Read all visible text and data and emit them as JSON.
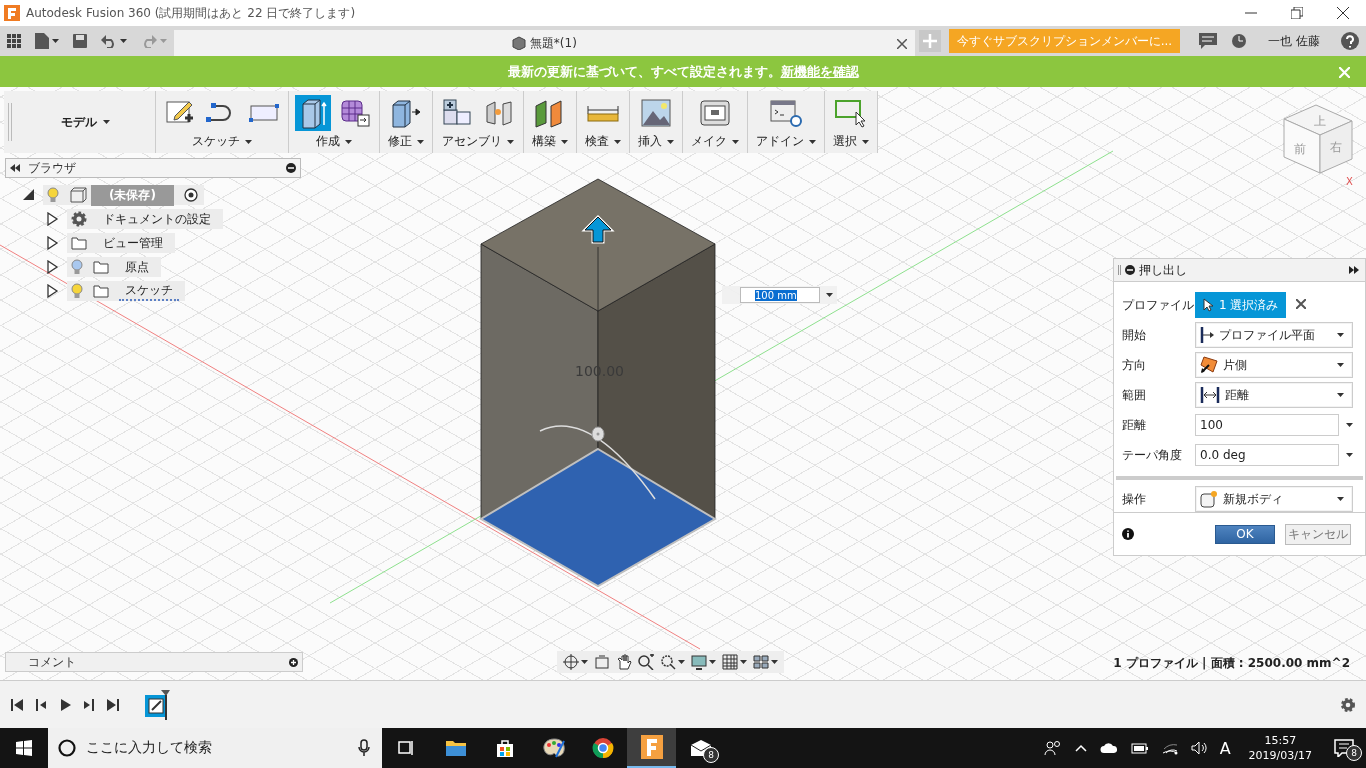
{
  "title_bar": {
    "title": "Autodesk Fusion 360 (試用期間はあと 22 日で終了します)"
  },
  "app_bar": {
    "document_tab": "無題*(1)",
    "subscribe_button": "今すぐサブスクリプションメンバーに...",
    "user_name": "一也 佐藤"
  },
  "banner": {
    "message": "最新の更新に基づいて、すべて設定されます。",
    "link": "新機能を確認"
  },
  "toolbar": {
    "workspace": "モデル",
    "groups": [
      {
        "label": "スケッチ",
        "tools": [
          {
            "kind": "sketch",
            "selected": false
          },
          {
            "kind": "spline",
            "selected": false
          },
          {
            "kind": "rect",
            "selected": false
          }
        ]
      },
      {
        "label": "作成",
        "tools": [
          {
            "kind": "box",
            "selected": true
          },
          {
            "kind": "form",
            "selected": false
          }
        ]
      },
      {
        "label": "修正",
        "tools": [
          {
            "kind": "presspull",
            "selected": false
          }
        ]
      },
      {
        "label": "アセンブリ",
        "tools": [
          {
            "kind": "component",
            "selected": false
          },
          {
            "kind": "joint",
            "selected": false
          }
        ]
      },
      {
        "label": "構築",
        "tools": [
          {
            "kind": "plane",
            "selected": false
          }
        ]
      },
      {
        "label": "検査",
        "tools": [
          {
            "kind": "measure",
            "selected": false
          }
        ]
      },
      {
        "label": "挿入",
        "tools": [
          {
            "kind": "image",
            "selected": false
          }
        ]
      },
      {
        "label": "メイク",
        "tools": [
          {
            "kind": "print",
            "selected": false
          }
        ]
      },
      {
        "label": "アドイン",
        "tools": [
          {
            "kind": "script",
            "selected": false
          }
        ]
      },
      {
        "label": "選択",
        "tools": [
          {
            "kind": "select",
            "selected": false
          }
        ]
      }
    ]
  },
  "browser": {
    "title": "ブラウザ",
    "tree": [
      {
        "label": "(未保存)",
        "kind": "component",
        "visible": true,
        "expanded": true,
        "children": [
          {
            "label": "ドキュメントの設定",
            "kind": "settings",
            "expanded": false
          },
          {
            "label": "ビュー管理",
            "kind": "folder",
            "expanded": false
          },
          {
            "label": "原点",
            "kind": "folder",
            "visible": false,
            "expanded": false
          },
          {
            "label": "スケッチ",
            "kind": "sketches",
            "visible": true,
            "expanded": false
          }
        ]
      }
    ]
  },
  "view_cube": {
    "top": "上",
    "front": "前",
    "right": "右",
    "axis": "X"
  },
  "viewport": {
    "dimension_label": "100.00",
    "distance_input": "100 mm"
  },
  "extrude_dialog": {
    "title": "押し出し",
    "rows": [
      {
        "kind": "selection",
        "label": "プロファイル",
        "value": "1 選択済み"
      },
      {
        "kind": "dropdown",
        "label": "開始",
        "value": "プロファイル平面"
      },
      {
        "kind": "dropdown",
        "label": "方向",
        "value": "片側"
      },
      {
        "kind": "dropdown",
        "label": "範囲",
        "value": "距離"
      },
      {
        "kind": "number",
        "label": "距離",
        "value": "100"
      },
      {
        "kind": "number",
        "label": "テーパ角度",
        "value": "0.0 deg"
      },
      {
        "kind": "separator"
      },
      {
        "kind": "dropdown",
        "label": "操作",
        "value": "新規ボディ"
      }
    ],
    "ok_button": "OK",
    "cancel_button": "キャンセル"
  },
  "comments": {
    "title": "コメント"
  },
  "status": "1 プロファイル | 面積 : 2500.00 mm^2",
  "taskbar": {
    "search_placeholder": "ここに入力して検索",
    "apps": [
      {
        "kind": "task-view",
        "selected": false
      },
      {
        "kind": "explorer",
        "selected": false
      },
      {
        "kind": "store",
        "selected": false
      },
      {
        "kind": "paint",
        "selected": false
      },
      {
        "kind": "chrome",
        "selected": false
      },
      {
        "kind": "fusion",
        "selected": true
      },
      {
        "kind": "mail",
        "selected": false,
        "badge": "8"
      }
    ],
    "ime": "A",
    "time": "15:57",
    "date": "2019/03/17",
    "notification_count": "8"
  }
}
